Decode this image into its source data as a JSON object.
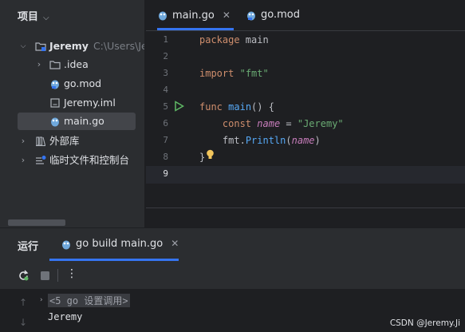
{
  "project": {
    "title": "项目",
    "tree": [
      {
        "label": "Jeremy",
        "hint": "C:\\Users\\Jer"
      },
      {
        "label": ".idea"
      },
      {
        "label": "go.mod"
      },
      {
        "label": "Jeremy.iml"
      },
      {
        "label": "main.go"
      },
      {
        "label": "外部库"
      },
      {
        "label": "临时文件和控制台"
      }
    ]
  },
  "editor": {
    "tabs": [
      {
        "label": "main.go",
        "active": true,
        "close": "✕"
      },
      {
        "label": "go.mod",
        "active": false
      }
    ],
    "line_numbers": [
      "1",
      "2",
      "3",
      "4",
      "5",
      "6",
      "7",
      "8",
      "9"
    ],
    "code": {
      "l1_kw": "package",
      "l1_rest": " main",
      "l3_kw": "import",
      "l3_str": "\"fmt\"",
      "l5_kw": "func",
      "l5_fn": "main",
      "l5_rest": "() {",
      "l6_kw": "const",
      "l6_var": "name",
      "l6_eq": " = ",
      "l6_str": "\"Jeremy\"",
      "l7_pkg": "fmt.",
      "l7_fn": "Println",
      "l7_open": "(",
      "l7_arg": "name",
      "l7_close": ")",
      "l8": "}"
    }
  },
  "run": {
    "title": "运行",
    "tab_label": "go build main.go",
    "tab_close": "✕",
    "menu_glyph": "⋮",
    "console": {
      "line1": "<5 go 设置调用>",
      "line2": "Jeremy"
    }
  },
  "watermark": "CSDN @Jeremy.Ji",
  "colors": {
    "accent": "#3574f0",
    "keyword": "#cf8e6d",
    "function": "#56a8f5",
    "string": "#6aab73",
    "param": "#c77dbb",
    "run_arrow": "#5fb865",
    "bulb": "#f2c55c"
  }
}
